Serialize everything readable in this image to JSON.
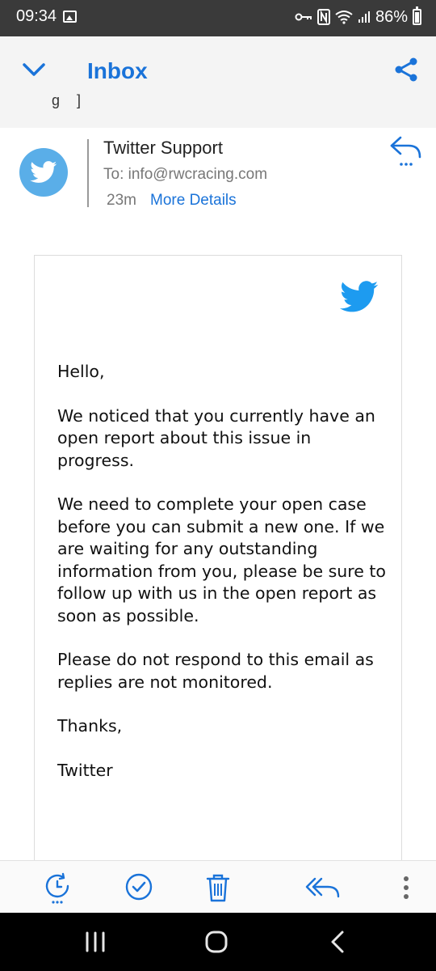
{
  "status_bar": {
    "time": "09:34",
    "battery": "86%"
  },
  "app_bar": {
    "title": "Inbox",
    "residual_text": "g ]"
  },
  "message": {
    "sender": "Twitter Support",
    "to_label": "To:",
    "to_address": "info@rwcracing.com",
    "age": "23m",
    "more_details": "More Details"
  },
  "email": {
    "paragraphs": [
      "Hello,",
      "We noticed that you currently have an open report about this issue in progress.",
      "We need to complete your open case before you can submit a new one. If we are waiting for any outstanding information from you, please be sure to follow up with us in the open report as soon as possible.",
      "Please do not respond to this email as replies are not monitored.",
      "Thanks,",
      "Twitter"
    ]
  },
  "colors": {
    "accent": "#1a73d9",
    "twitter_blue": "#1d9bf0",
    "avatar_blue": "#5aaee8",
    "status_bar": "#3a3a3a"
  },
  "icons": {
    "back": "chevron-down-icon",
    "share": "share-icon",
    "reply": "reply-icon",
    "snooze": "snooze-icon",
    "mark_read": "check-circle-icon",
    "delete": "trash-icon",
    "reply_all": "reply-all-icon",
    "more": "more-vertical-icon"
  }
}
